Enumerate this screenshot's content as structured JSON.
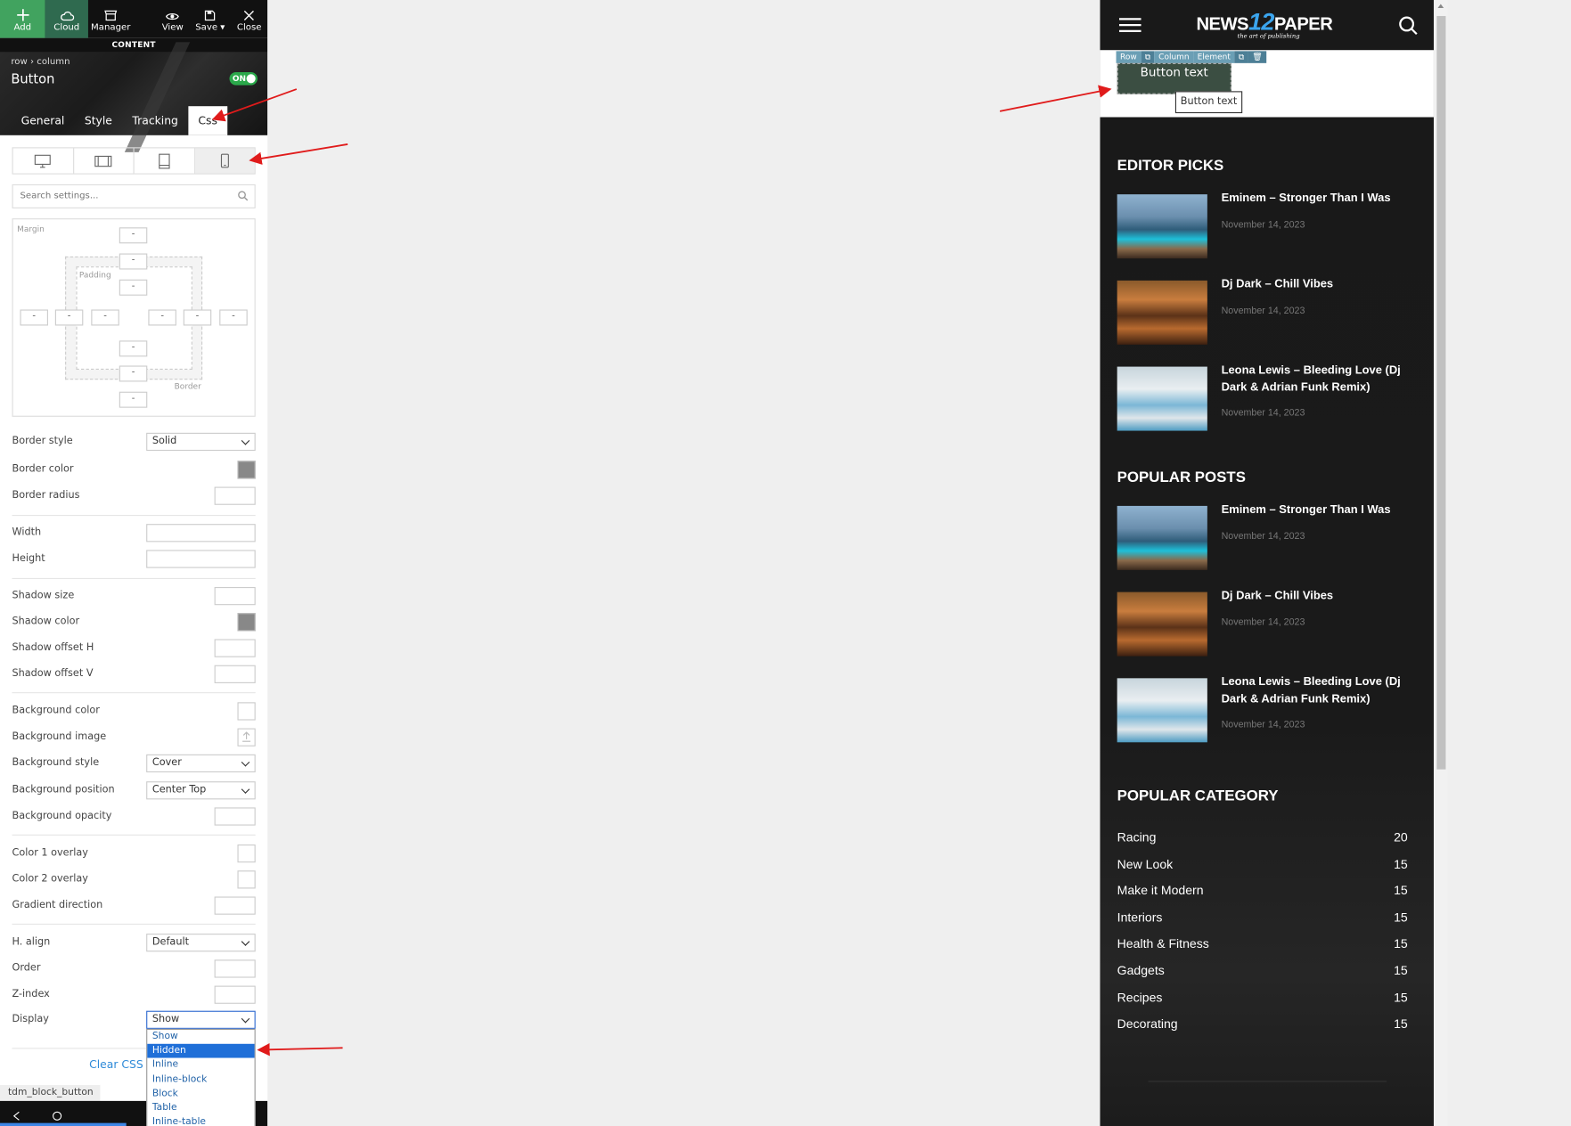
{
  "toolbar": {
    "add": "Add",
    "cloud": "Cloud",
    "manager": "Manager",
    "view": "View",
    "save": "Save ▾",
    "close": "Close"
  },
  "content_label": "CONTENT",
  "breadcrumb": {
    "parent": "row",
    "sep": "›",
    "child": "column"
  },
  "element_title": "Button",
  "toggle_label": "ON",
  "tabs": [
    "General",
    "Style",
    "Tracking",
    "Css"
  ],
  "search": {
    "placeholder": "Search settings..."
  },
  "box_model": {
    "margin": "Margin",
    "padding": "Padding",
    "border": "Border",
    "placeholder_value": "-"
  },
  "settings": {
    "border_style": {
      "label": "Border style",
      "value": "Solid"
    },
    "border_color": "Border color",
    "border_radius": "Border radius",
    "width": "Width",
    "height": "Height",
    "shadow_size": "Shadow size",
    "shadow_color": "Shadow color",
    "shadow_offset_h": "Shadow offset H",
    "shadow_offset_v": "Shadow offset V",
    "background_color": "Background color",
    "background_image": "Background image",
    "background_style": {
      "label": "Background style",
      "value": "Cover"
    },
    "background_position": {
      "label": "Background position",
      "value": "Center Top"
    },
    "background_opacity": "Background opacity",
    "color1_overlay": "Color 1 overlay",
    "color2_overlay": "Color 2 overlay",
    "gradient_direction": "Gradient direction",
    "h_align": {
      "label": "H. align",
      "value": "Default"
    },
    "order": "Order",
    "z_index": "Z-index",
    "display": {
      "label": "Display",
      "value": "Show"
    }
  },
  "display_options": [
    "Show",
    "Hidden",
    "Inline",
    "Inline-block",
    "Block",
    "Table",
    "Inline-table"
  ],
  "display_highlighted": "Hidden",
  "clear_css": "Clear CSS s",
  "block_tag": "tdm_block_button",
  "preview": {
    "logo_left": "NEWS",
    "logo_num": "12",
    "logo_right": "PAPER",
    "logo_tagline": "the art of publishing",
    "element_toolbar": [
      "Row",
      "Column",
      "Element"
    ],
    "button_text": "Button text",
    "tooltip": "Button text",
    "editor_picks": {
      "heading": "EDITOR PICKS",
      "posts": [
        {
          "title": "Eminem – Stronger Than I Was",
          "date": "November 14, 2023"
        },
        {
          "title": "Dj Dark – Chill Vibes",
          "date": "November 14, 2023"
        },
        {
          "title": "Leona Lewis – Bleeding Love (Dj Dark & Adrian Funk Remix)",
          "date": "November 14, 2023"
        }
      ]
    },
    "popular_posts": {
      "heading": "POPULAR POSTS",
      "posts": [
        {
          "title": "Eminem – Stronger Than I Was",
          "date": "November 14, 2023"
        },
        {
          "title": "Dj Dark – Chill Vibes",
          "date": "November 14, 2023"
        },
        {
          "title": "Leona Lewis – Bleeding Love (Dj Dark & Adrian Funk Remix)",
          "date": "November 14, 2023"
        }
      ]
    },
    "popular_category": {
      "heading": "POPULAR CATEGORY",
      "items": [
        {
          "name": "Racing",
          "count": "20"
        },
        {
          "name": "New Look",
          "count": "15"
        },
        {
          "name": "Make it Modern",
          "count": "15"
        },
        {
          "name": "Interiors",
          "count": "15"
        },
        {
          "name": "Health & Fitness",
          "count": "15"
        },
        {
          "name": "Gadgets",
          "count": "15"
        },
        {
          "name": "Recipes",
          "count": "15"
        },
        {
          "name": "Decorating",
          "count": "15"
        }
      ]
    }
  },
  "colors": {
    "add": "#41a35f",
    "cloud": "#2f6a4f",
    "toggle": "#2aa84a",
    "arrow": "#e01b1b",
    "link": "#2e8ad8",
    "highlight": "#1f6fd8"
  }
}
